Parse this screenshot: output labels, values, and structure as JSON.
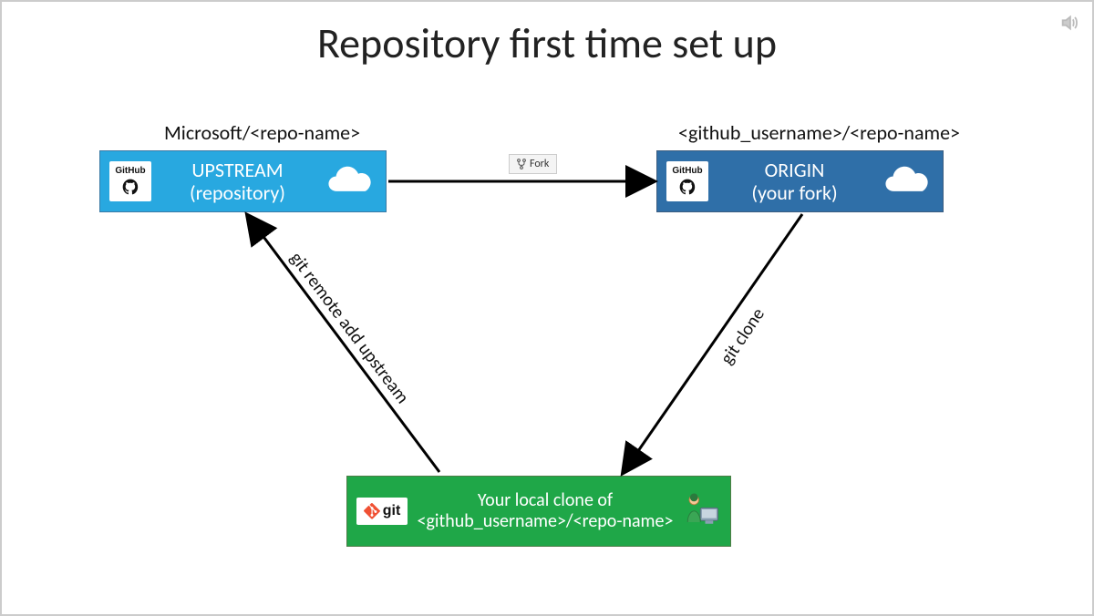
{
  "title": "Repository first time set up",
  "upstream": {
    "label_above": "Microsoft/<repo-name>",
    "title_line1": "UPSTREAM",
    "title_line2": "(repository)",
    "logo_text": "GitHub"
  },
  "origin": {
    "label_above": "<github_username>/<repo-name>",
    "title_line1": "ORIGIN",
    "title_line2": "(your fork)",
    "logo_text": "GitHub"
  },
  "local": {
    "line1": "Your local clone of",
    "line2": "<github_username>/<repo-name>",
    "logo_text": "git"
  },
  "arrows": {
    "fork_label": "Fork",
    "clone_label": "git clone",
    "remote_label": "git remote add upstream"
  },
  "colors": {
    "upstream_bg": "#28a8e0",
    "origin_bg": "#2f6fa8",
    "local_bg": "#1fa748",
    "arrow": "#000000"
  }
}
